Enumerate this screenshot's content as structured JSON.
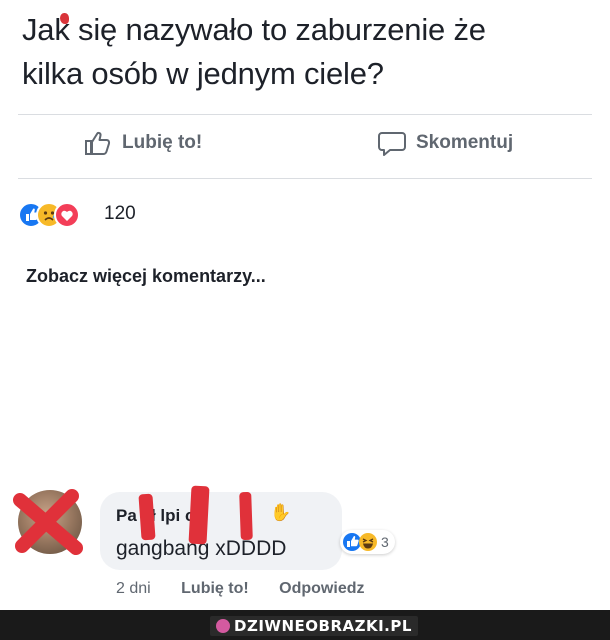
{
  "post": {
    "text_line1": "Jak się nazywało to zaburzenie że",
    "text_line2": "kilka osób w jednym ciele?"
  },
  "actions": {
    "like_label": "Lubię to!",
    "comment_label": "Skomentuj"
  },
  "reactions": {
    "icons": [
      "like-icon",
      "sad-icon",
      "love-icon"
    ],
    "count": "120"
  },
  "comments": {
    "more_label": "Zobacz więcej komentarzy...",
    "item": {
      "author": "Pa  eł   lpi  c",
      "text": "gangbang xDDDD",
      "reaction_icons": [
        "like-icon",
        "haha-icon"
      ],
      "reaction_count": "3",
      "time": "2 dni",
      "like_label": "Lubię to!",
      "reply_label": "Odpowiedz"
    }
  },
  "watermark": {
    "text": "DZIWNEOBRAZKI.PL"
  },
  "colors": {
    "facebook_blue": "#1877f2",
    "love_red": "#f33e58",
    "haha_yellow": "#f7b928",
    "redaction_red": "#e0313a"
  }
}
